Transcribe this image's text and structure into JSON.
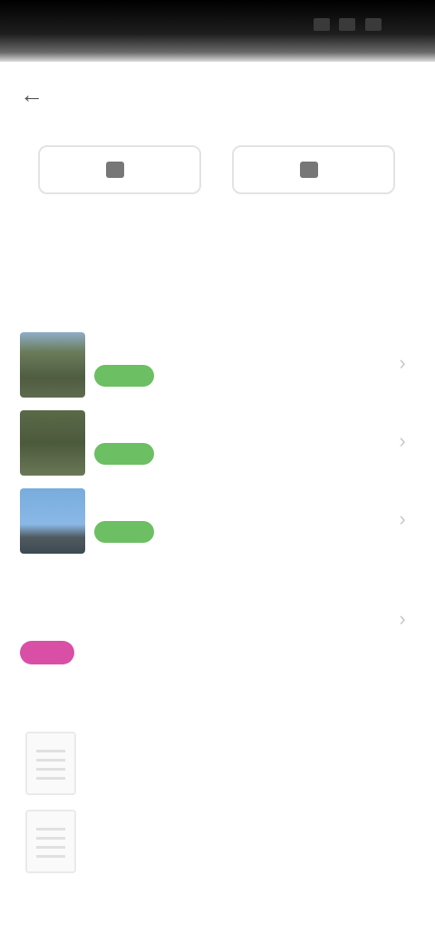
{
  "status_bar": {
    "time": "",
    "icons": [
      "signal-icon",
      "wifi-icon",
      "battery-icon"
    ]
  },
  "header": {
    "title": "",
    "back_icon": "back-arrow-icon"
  },
  "toolbar": {
    "left_label": "",
    "right_label": "",
    "left_icon": "edit-icon",
    "right_icon": "share-icon"
  },
  "stats": [
    {
      "label": "",
      "value": ""
    },
    {
      "label": "",
      "value": ""
    }
  ],
  "sections": {
    "media_label": "",
    "docs_label": ""
  },
  "media_items": [
    {
      "title": "",
      "badge": "",
      "thumb": "forest"
    },
    {
      "title": "",
      "badge": "",
      "thumb": "forest2"
    },
    {
      "title": "",
      "badge": "",
      "thumb": "sky"
    }
  ],
  "project": {
    "title": "",
    "meta": "",
    "badge": ""
  },
  "documents": [
    {
      "title": ""
    },
    {
      "title": ""
    }
  ],
  "colors": {
    "accent_green": "#6cbf62",
    "accent_pink": "#d94fa6",
    "border": "#e3e3e3"
  }
}
